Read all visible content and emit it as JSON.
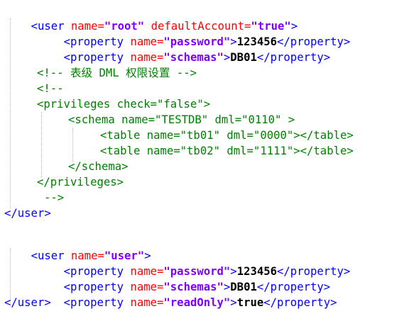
{
  "line1": {
    "open": "<user ",
    "attr1": "name=",
    "val1": "\"root\"",
    "sep": " ",
    "attr2": "defaultAccount=",
    "val2": "\"true\"",
    "close": ">"
  },
  "line2": {
    "open": "<property ",
    "attr": "name=",
    "val": "\"password\"",
    "gt": ">",
    "text": "123456",
    "close": "</property>"
  },
  "line3": {
    "open": "<property ",
    "attr": "name=",
    "val": "\"schemas\"",
    "gt": ">",
    "text": "DB01",
    "close": "</property>"
  },
  "line5": {
    "comment": "<!-- 表级 DML 权限设置 -->"
  },
  "line6": {
    "comment": "<!--"
  },
  "line7": {
    "comment": "<privileges check=\"false\">"
  },
  "line8": {
    "comment": "<schema name=\"TESTDB\" dml=\"0110\" >"
  },
  "line9": {
    "comment": "<table name=\"tb01\" dml=\"0000\"></table>"
  },
  "line10": {
    "comment": "<table name=\"tb02\" dml=\"1111\"></table>"
  },
  "line11": {
    "comment": "</schema>"
  },
  "line12": {
    "comment": "</privileges>"
  },
  "line13": {
    "comment": "-->"
  },
  "line14": {
    "close": "</user>"
  },
  "line16": {
    "open": "<user ",
    "attr": "name=",
    "val": "\"user\"",
    "close": ">"
  },
  "line17": {
    "open": "<property ",
    "attr": "name=",
    "val": "\"password\"",
    "gt": ">",
    "text": "123456",
    "close": "</property>"
  },
  "line18": {
    "open": "<property ",
    "attr": "name=",
    "val": "\"schemas\"",
    "gt": ">",
    "text": "DB01",
    "close": "</property>"
  },
  "line19": {
    "open": "<property ",
    "attr": "name=",
    "val": "\"readOnly\"",
    "gt": ">",
    "text": "true",
    "close": "</property>"
  },
  "line20": {
    "close": "</user>"
  },
  "colors": {
    "tag": "#0000ff",
    "attribute": "#ff0000",
    "value": "#8000ff",
    "text": "#000000",
    "comment": "#008000",
    "background": "#ffffff"
  }
}
